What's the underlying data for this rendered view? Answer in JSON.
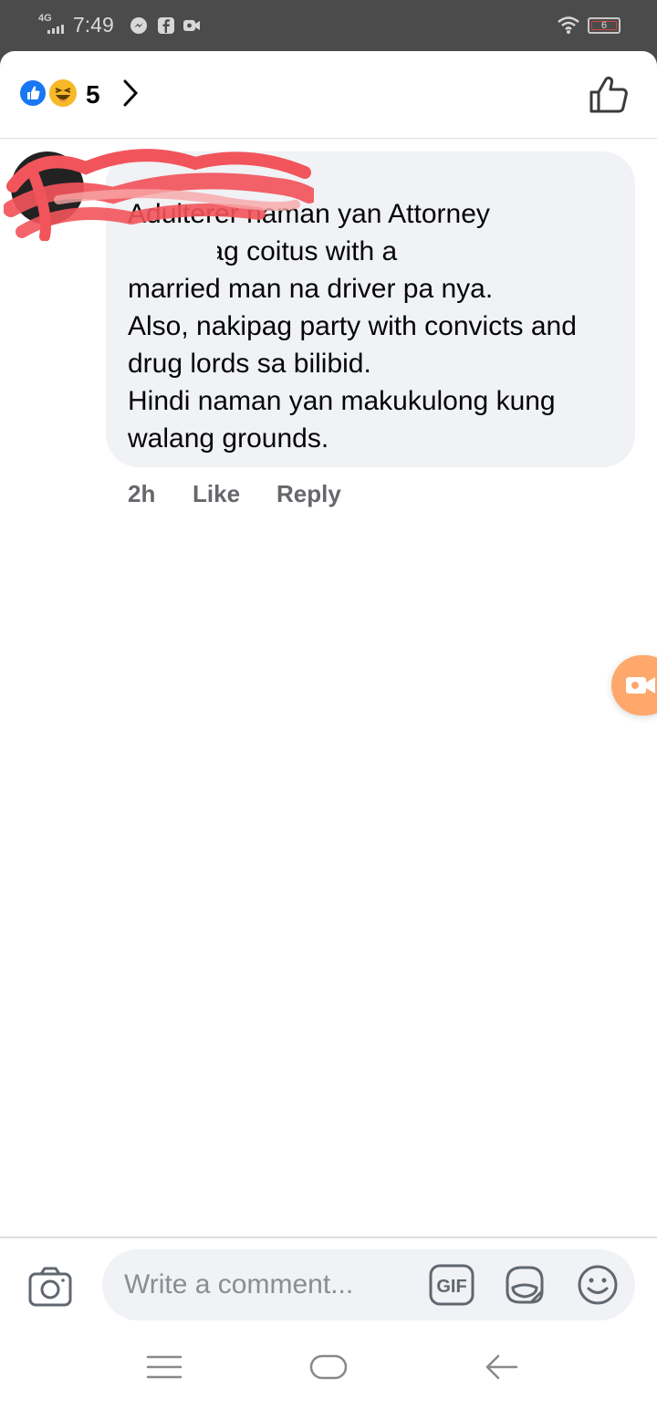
{
  "status_bar": {
    "network": "4G",
    "time": "7:49",
    "battery": "6",
    "icons": [
      "messenger-icon",
      "facebook-icon",
      "video-icon",
      "wifi-icon",
      "battery-icon"
    ],
    "battery_alert_color": "#d0453f"
  },
  "reactions": {
    "icons": [
      "like-reaction-icon",
      "haha-reaction-icon"
    ],
    "count": "5",
    "like_color": "#1877f2",
    "haha_color": "#f7b928"
  },
  "comment": {
    "author": "",
    "text": "Adulterer naman yan Attorney\n, nakipag coitus with a\nmarried man na driver pa nya.\nAlso, nakipag party with convicts and\ndrug lords sa bilibid.\nHindi naman yan makukulong kung\nwalang grounds.",
    "time": "2h",
    "like_label": "Like",
    "reply_label": "Reply",
    "redaction_color": "#f2545b"
  },
  "composer": {
    "placeholder": "Write a comment...",
    "gif_label": "GIF"
  },
  "colors": {
    "bubble_bg": "#f0f2f5",
    "secondary_text": "#65676b",
    "floating_button": "#ffa86b"
  }
}
